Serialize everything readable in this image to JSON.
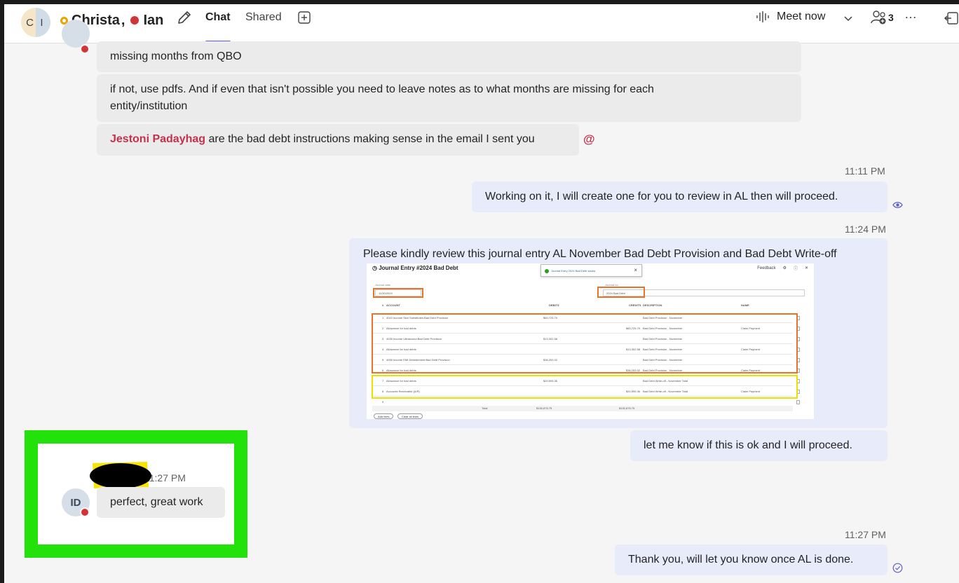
{
  "header": {
    "avatar_left": "C",
    "avatar_right": "I",
    "participant_1": "Christa",
    "separator": ",",
    "participant_2": "Ian",
    "tabs": [
      {
        "label": "Chat",
        "active": true
      },
      {
        "label": "Shared",
        "active": false
      }
    ],
    "meet_now": "Meet now",
    "participant_count": "3",
    "more": "…"
  },
  "messages": [
    {
      "id": "m1",
      "direction": "incoming",
      "text": "missing months from QBO"
    },
    {
      "id": "m2",
      "direction": "incoming",
      "text_line1": "if not, use pdfs.  And if even that isn't possible you need to leave notes as to what months are missing for each",
      "text_line2": "entity/institution"
    },
    {
      "id": "m3",
      "direction": "incoming",
      "mention": "Jestoni Padayhag",
      "text": " are the bad debt instructions making sense in the email I sent you",
      "reaction": "@"
    },
    {
      "id": "m4",
      "direction": "outgoing",
      "timestamp": "11:11 PM",
      "text": "Working on it, I will create one for you to review in AL then will proceed."
    },
    {
      "id": "m5",
      "direction": "outgoing",
      "timestamp": "11:24 PM",
      "text": "Please kindly review this journal entry AL November Bad Debt Provision and Bad Debt Write-off"
    },
    {
      "id": "m6",
      "direction": "outgoing",
      "text": "let me know if this is ok and I will proceed."
    },
    {
      "id": "m7",
      "direction": "incoming",
      "timestamp": "11:27 PM",
      "avatar": "ID",
      "text": "perfect, great work"
    },
    {
      "id": "m8",
      "direction": "outgoing",
      "timestamp": "11:27 PM",
      "text": "Thank you, will let you know once AL is done."
    }
  ],
  "journal_entry": {
    "title": "Journal Entry #2024 Bad Debt",
    "toast": "Journal Entry 2024 Bad Debt saved",
    "feedback": "Feedback",
    "journal_date_label": "Journal date",
    "journal_date": "11/30/2024",
    "journal_no_label": "Journal no.",
    "journal_no": "2024 Bad Debt",
    "columns": {
      "num": "#",
      "account": "ACCOUNT",
      "debits": "DEBITS",
      "credits": "CREDITS",
      "description": "DESCRIPTION",
      "name": "NAME"
    },
    "rows": [
      {
        "num": "1",
        "account": "4010 Income Skin Substitutes:Bad Debt Provision",
        "debit": "$60,725.79",
        "credit": "",
        "description": "Bad Debt Provision - November",
        "name": ""
      },
      {
        "num": "2",
        "account": "Allowance for bad debts",
        "debit": "",
        "credit": "$60,725.79",
        "description": "Bad Debt Provision - November",
        "name": "Claim Payment"
      },
      {
        "num": "3",
        "account": "4035 Income Ultrasound:Bad Debt Provision",
        "debit": "$13,302.58",
        "credit": "",
        "description": "Bad Debt Provision - November",
        "name": ""
      },
      {
        "num": "4",
        "account": "Allowance for bad debts",
        "debit": "",
        "credit": "$13,302.58",
        "description": "Bad Debt Provision - November",
        "name": "Claim Payment"
      },
      {
        "num": "5",
        "account": "4055 Income EMI Debridement:Bad Debt Provision",
        "debit": "$36,253.02",
        "credit": "",
        "description": "Bad Debt Provision - November",
        "name": ""
      },
      {
        "num": "6",
        "account": "Allowance for bad debts",
        "debit": "",
        "credit": "$36,253.02",
        "description": "Bad Debt Provision - November",
        "name": "Claim Payment"
      },
      {
        "num": "7",
        "account": "Allowance for bad debts",
        "debit": "$20,595.36",
        "credit": "",
        "description": "Bad Debt Write-off - November Total",
        "name": ""
      },
      {
        "num": "8",
        "account": "Accounts Receivable (A/R)",
        "debit": "",
        "credit": "$20,595.36",
        "description": "Bad Debt Write-off - November Total",
        "name": "Claim Payment"
      },
      {
        "num": "9",
        "account": "",
        "debit": "",
        "credit": "",
        "description": "",
        "name": ""
      }
    ],
    "total_label": "Total",
    "total_debit": "$130,876.75",
    "total_credit": "$130,876.75",
    "add_lines": "Add lines",
    "clear_lines": "Clear all lines"
  },
  "colors": {
    "accent": "#5b5fc7",
    "mention": "#c4314b",
    "busy": "#d13438",
    "away": "#eaa300",
    "highlight_box": "#23e10a",
    "orange_highlight": "#e8732a",
    "yellow_highlight": "#ebe000"
  }
}
